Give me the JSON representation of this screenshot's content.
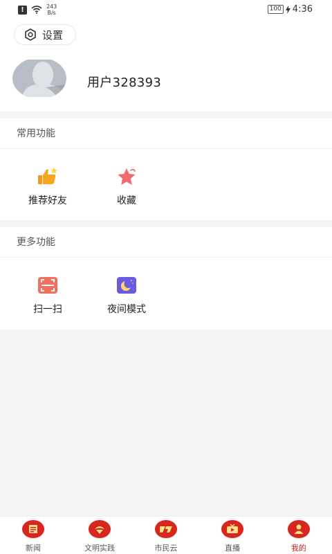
{
  "status_bar": {
    "alert_glyph": "!",
    "net_speed_value": "243",
    "net_speed_unit": "B/s",
    "battery": "100",
    "time": "4:36"
  },
  "profile": {
    "settings_label": "设置",
    "username": "用户328393"
  },
  "common": {
    "title": "常用功能",
    "items": [
      {
        "label": "推荐好友",
        "icon": "thumbs-up-star-icon"
      },
      {
        "label": "收藏",
        "icon": "star-icon"
      }
    ]
  },
  "more": {
    "title": "更多功能",
    "items": [
      {
        "label": "扫一扫",
        "icon": "scan-icon"
      },
      {
        "label": "夜间模式",
        "icon": "night-mode-icon"
      }
    ]
  },
  "bottom_nav": {
    "items": [
      {
        "label": "新闻",
        "icon": "news-icon"
      },
      {
        "label": "文明实践",
        "icon": "civilization-practice-icon"
      },
      {
        "label": "市民云",
        "icon": "citizen-cloud-icon"
      },
      {
        "label": "直播",
        "icon": "live-icon"
      },
      {
        "label": "我的",
        "icon": "profile-icon",
        "active": true
      }
    ],
    "active_color": "#c51f18",
    "icon_color": "#d8251d"
  }
}
